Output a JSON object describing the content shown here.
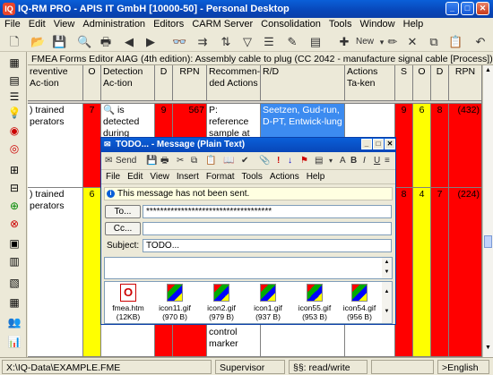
{
  "window": {
    "title": "IQ-RM PRO - APIS IT GmbH [10000-50] - Personal Desktop",
    "app_icon": "IQ"
  },
  "menu": [
    "File",
    "Edit",
    "View",
    "Administration",
    "Editors",
    "CARM Server",
    "Consolidation",
    "Tools",
    "Window",
    "Help"
  ],
  "toolbar": {
    "new_label": "New"
  },
  "document": {
    "title": "FMEA Forms Editor AIAG (4th edition): Assembly cable to plug (CC 2042 - manufacture signal cable [Process])",
    "headers": {
      "prev": "reventive Ac-tion",
      "o": "O",
      "detection": "Detection Ac-tion",
      "d": "D",
      "rpn": "RPN",
      "rec": "Recommen-ded Actions",
      "rd": "R/D",
      "taken": "Actions Ta-ken",
      "s2": "S",
      "o2": "O",
      "d2": "D",
      "rpn2": "RPN"
    },
    "rows": [
      {
        "prev": ") trained perators",
        "o": "7",
        "detection": "is detected during",
        "d": "9",
        "rpn": "567",
        "rec": "P: reference sample at",
        "rd": "Seetzen, Gud-run, D-PT, Entwick-lung",
        "s2": "9",
        "o2": "6",
        "d2": "8",
        "rpn2": "(432)"
      },
      {
        "prev": ") trained perators",
        "o": "6",
        "detection": "",
        "d": "",
        "rpn": "",
        "rec": "",
        "rd": "",
        "s2": "8",
        "o2": "4",
        "d2": "7",
        "rpn2": "(224)"
      },
      {
        "rec": "control marker"
      }
    ]
  },
  "message": {
    "title": "TODO... - Message (Plain Text)",
    "toolbar": {
      "send": "Send"
    },
    "menu": [
      "File",
      "Edit",
      "View",
      "Insert",
      "Format",
      "Tools",
      "Actions",
      "Help"
    ],
    "info": "This message has not been sent.",
    "to_label": "To...",
    "to_value": "************************************",
    "cc_label": "Cc...",
    "cc_value": "",
    "subject_label": "Subject:",
    "subject_value": "TODO...",
    "attachments": [
      {
        "name": "fmea.htm",
        "size": "(12KB)",
        "type": "pdf"
      },
      {
        "name": "icon11.gif",
        "size": "(970 B)",
        "type": "gif"
      },
      {
        "name": "icon2.gif",
        "size": "(979 B)",
        "type": "gif"
      },
      {
        "name": "icon1.gif",
        "size": "(937 B)",
        "type": "gif"
      },
      {
        "name": "icon55.gif",
        "size": "(953 B)",
        "type": "gif"
      },
      {
        "name": "icon54.gif",
        "size": "(956 B)",
        "type": "gif"
      }
    ]
  },
  "status": {
    "path": "X:\\IQ-Data\\EXAMPLE.FME",
    "role": "Supervisor",
    "mode": "§§: read/write",
    "language": ">English"
  },
  "colors": {
    "red": "#ff0000",
    "yellow": "#ffff00",
    "blue": "#3c8bf0"
  }
}
